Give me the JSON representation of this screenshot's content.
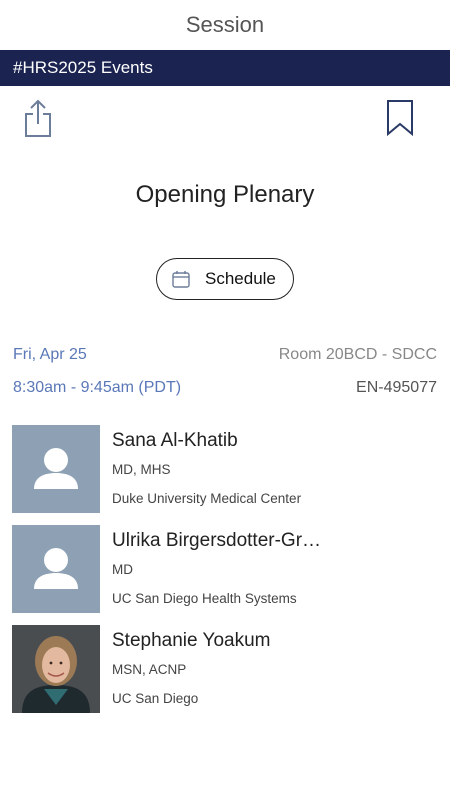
{
  "header": {
    "title": "Session"
  },
  "event_bar": {
    "label": "#HRS2025 Events"
  },
  "actions": {
    "share_icon": "share-icon",
    "bookmark_icon": "bookmark-icon"
  },
  "session": {
    "title": "Opening Plenary",
    "schedule_label": "Schedule",
    "date": "Fri, Apr 25",
    "time": "8:30am - 9:45am  (PDT)",
    "room": "Room 20BCD - SDCC",
    "code": "EN-495077"
  },
  "speakers": [
    {
      "name": "Sana Al-Khatib",
      "credentials": "MD, MHS",
      "organization": "Duke University Medical Center",
      "avatar": "placeholder"
    },
    {
      "name": "Ulrika Birgersdotter-Gr…",
      "credentials": "MD",
      "organization": "UC San Diego Health Systems",
      "avatar": "placeholder"
    },
    {
      "name": "Stephanie Yoakum",
      "credentials": "MSN, ACNP",
      "organization": "UC San Diego",
      "avatar": "photo"
    }
  ],
  "colors": {
    "event_bar": "#1b2450",
    "date_text": "#5a78b8",
    "avatar_placeholder": "#8da0b4"
  }
}
